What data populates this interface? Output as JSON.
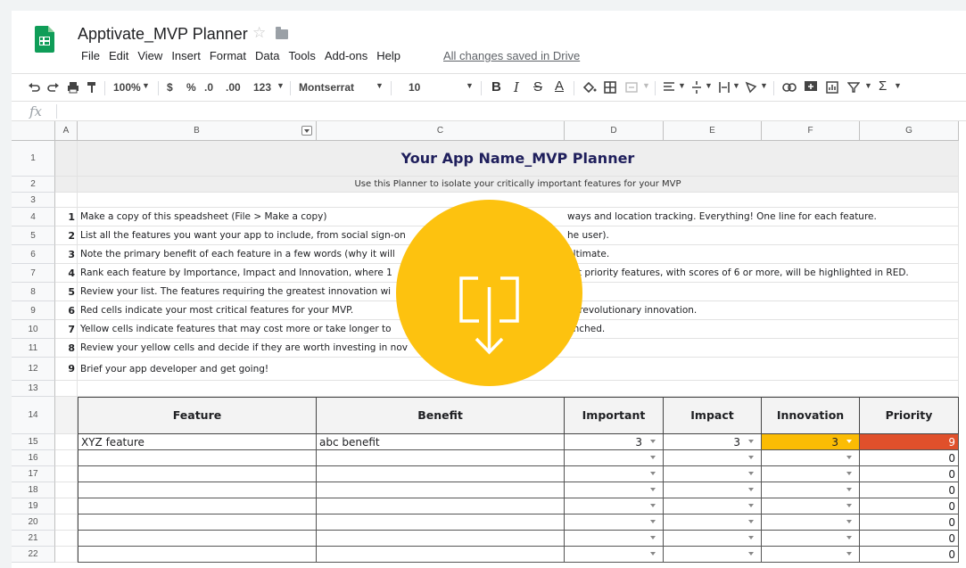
{
  "app": {
    "doc_title": "Apptivate_MVP Planner",
    "menu": [
      "File",
      "Edit",
      "View",
      "Insert",
      "Format",
      "Data",
      "Tools",
      "Add-ons",
      "Help"
    ],
    "save_status": "All changes saved in Drive",
    "brand_color": "#0f9d58"
  },
  "toolbar": {
    "zoom": "100%",
    "currency": "$",
    "percent": "%",
    "dec_decrease": ".0",
    "dec_increase": ".00",
    "more_formats": "123",
    "font": "Montserrat",
    "font_size": "10",
    "icons": [
      "undo-icon",
      "redo-icon",
      "print-icon",
      "paint-format-icon",
      "bold-icon",
      "italic-icon",
      "strikethrough-icon",
      "text-color-icon",
      "fill-color-icon",
      "borders-icon",
      "merge-icon",
      "align-icon",
      "valign-icon",
      "wrap-icon",
      "rotate-icon",
      "link-icon",
      "comment-icon",
      "chart-icon",
      "filter-icon",
      "functions-icon"
    ]
  },
  "formula_bar": {
    "label": "fx",
    "value": ""
  },
  "columns": [
    "A",
    "B",
    "C",
    "D",
    "E",
    "F",
    "G"
  ],
  "sheet": {
    "title": "Your App Name_MVP Planner",
    "subtitle": "Use this Planner to isolate your critically important features for your MVP",
    "instructions": [
      {
        "n": "1",
        "text": "Make a copy of this speadsheet (File > Make a copy)"
      },
      {
        "n": "2",
        "text": "List all the features you want your app to include, from social sign-on"
      },
      {
        "n": "3",
        "text": "Note the primary benefit of each feature in a few words (why it will"
      },
      {
        "n": "4",
        "text": "Rank each feature by Importance, Impact and Innovation, where 1"
      },
      {
        "n": "5",
        "text": "Review your list. The features requiring the greatest innovation wi"
      },
      {
        "n": "6",
        "text": "Red cells indicate your most critical features for your MVP."
      },
      {
        "n": "7",
        "text": "Yellow cells indicate features that may cost more or take longer to"
      },
      {
        "n": "8",
        "text": "Review your yellow cells and decide if they are worth investing in nov"
      },
      {
        "n": "9",
        "text": "Brief your app developer and get going!"
      }
    ],
    "instructions_tail": [
      "ways and location tracking. Everything! One line for each feature.",
      "he user).",
      "ultimate.",
      "est priority features, with scores of 6 or more, will be highlighted in RED.",
      "",
      "g, revolutionary innovation.",
      "unched.",
      ""
    ],
    "table_headers": [
      "Feature",
      "Benefit",
      "Important",
      "Impact",
      "Innovation",
      "Priority"
    ],
    "rows": [
      {
        "feature": "XYZ feature",
        "benefit": "abc benefit",
        "important": "3",
        "impact": "3",
        "innovation": "3",
        "priority": "9"
      },
      {
        "feature": "",
        "benefit": "",
        "important": "",
        "impact": "",
        "innovation": "",
        "priority": "0"
      },
      {
        "feature": "",
        "benefit": "",
        "important": "",
        "impact": "",
        "innovation": "",
        "priority": "0"
      },
      {
        "feature": "",
        "benefit": "",
        "important": "",
        "impact": "",
        "innovation": "",
        "priority": "0"
      },
      {
        "feature": "",
        "benefit": "",
        "important": "",
        "impact": "",
        "innovation": "",
        "priority": "0"
      },
      {
        "feature": "",
        "benefit": "",
        "important": "",
        "impact": "",
        "innovation": "",
        "priority": "0"
      },
      {
        "feature": "",
        "benefit": "",
        "important": "",
        "impact": "",
        "innovation": "",
        "priority": "0"
      },
      {
        "feature": "",
        "benefit": "",
        "important": "",
        "impact": "",
        "innovation": "",
        "priority": "0"
      }
    ],
    "row_numbers": [
      "1",
      "2",
      "3",
      "4",
      "5",
      "6",
      "7",
      "8",
      "9",
      "10",
      "11",
      "12",
      "13",
      "14",
      "15",
      "16",
      "17",
      "18",
      "19",
      "20",
      "21",
      "22"
    ]
  },
  "colors": {
    "innovation_highlight": "#fbbc04",
    "priority_highlight": "#e0502b",
    "overlay": "#fdc20f",
    "header_bg": "#eeeeee"
  },
  "overlay": {
    "icon": "download-icon"
  }
}
